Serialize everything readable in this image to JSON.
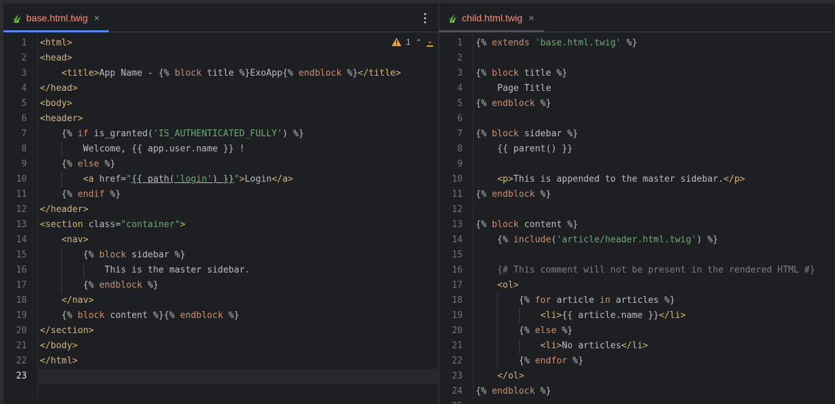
{
  "left_tab": {
    "label": "base.html.twig",
    "close": "×"
  },
  "right_tab": {
    "label": "child.html.twig",
    "close": "×"
  },
  "inspection": {
    "warning_count": "1",
    "up": "⌃",
    "down": "⌄"
  },
  "left_lines": [
    [
      [
        "t-tag",
        "<html>"
      ]
    ],
    [
      [
        "t-tag",
        "<head>"
      ]
    ],
    [
      [
        "t-txt",
        "    "
      ],
      [
        "t-tag",
        "<title>"
      ],
      [
        "t-txt",
        "App Name - {% "
      ],
      [
        "t-kw",
        "block"
      ],
      [
        "t-txt",
        " title %}ExoApp{% "
      ],
      [
        "t-kw",
        "endblock"
      ],
      [
        "t-txt",
        " %}"
      ],
      [
        "t-tag",
        "</title>"
      ]
    ],
    [
      [
        "t-tag",
        "</head>"
      ]
    ],
    [
      [
        "t-tag",
        "<body>"
      ]
    ],
    [
      [
        "t-tag",
        "<header>"
      ]
    ],
    [
      [
        "t-txt",
        "    {% "
      ],
      [
        "t-kw",
        "if"
      ],
      [
        "t-txt",
        " is_granted("
      ],
      [
        "t-str",
        "'IS_AUTHENTICATED_FULLY'"
      ],
      [
        "t-txt",
        ") %}"
      ]
    ],
    [
      [
        "t-txt",
        "        Welcome, {{ app.user.name }} !"
      ]
    ],
    [
      [
        "t-txt",
        "    {% "
      ],
      [
        "t-kw",
        "else"
      ],
      [
        "t-txt",
        " %}"
      ]
    ],
    [
      [
        "t-txt",
        "        "
      ],
      [
        "t-tag",
        "<a "
      ],
      [
        "t-attr",
        "href="
      ],
      [
        "t-str",
        "\""
      ],
      [
        "t-link",
        "{{ path("
      ],
      [
        "t-str t-link",
        "'login'"
      ],
      [
        "t-link",
        ") }}"
      ],
      [
        "t-str",
        "\""
      ],
      [
        "t-tag",
        ">"
      ],
      [
        "t-txt",
        "Login"
      ],
      [
        "t-tag",
        "</a>"
      ]
    ],
    [
      [
        "t-txt",
        "    {% "
      ],
      [
        "t-kw",
        "endif"
      ],
      [
        "t-txt",
        " %}"
      ]
    ],
    [
      [
        "t-tag",
        "</header>"
      ]
    ],
    [
      [
        "t-tag",
        "<section "
      ],
      [
        "t-attr",
        "class="
      ],
      [
        "t-str",
        "\"container\""
      ],
      [
        "t-tag",
        ">"
      ]
    ],
    [
      [
        "t-txt",
        "    "
      ],
      [
        "t-tag",
        "<nav>"
      ]
    ],
    [
      [
        "t-txt",
        "        {% "
      ],
      [
        "t-kw",
        "block"
      ],
      [
        "t-txt",
        " sidebar %}"
      ]
    ],
    [
      [
        "t-txt",
        "            This is the master sidebar."
      ]
    ],
    [
      [
        "t-txt",
        "        {% "
      ],
      [
        "t-kw",
        "endblock"
      ],
      [
        "t-txt",
        " %}"
      ]
    ],
    [
      [
        "t-txt",
        "    "
      ],
      [
        "t-tag",
        "</nav>"
      ]
    ],
    [
      [
        "t-txt",
        "    {% "
      ],
      [
        "t-kw",
        "block"
      ],
      [
        "t-txt",
        " content %}{% "
      ],
      [
        "t-kw",
        "endblock"
      ],
      [
        "t-txt",
        " %}"
      ]
    ],
    [
      [
        "t-tag",
        "</section>"
      ]
    ],
    [
      [
        "t-tag",
        "</body>"
      ]
    ],
    [
      [
        "t-tag",
        "</html>"
      ]
    ],
    []
  ],
  "right_lines": [
    [
      [
        "t-txt",
        "{% "
      ],
      [
        "t-kw",
        "extends"
      ],
      [
        "t-txt",
        " "
      ],
      [
        "t-str",
        "'base.html.twig'"
      ],
      [
        "t-txt",
        " %}"
      ]
    ],
    [],
    [
      [
        "t-txt",
        "{% "
      ],
      [
        "t-kw",
        "block"
      ],
      [
        "t-txt",
        " title %}"
      ]
    ],
    [
      [
        "t-txt",
        "    Page Title"
      ]
    ],
    [
      [
        "t-txt",
        "{% "
      ],
      [
        "t-kw",
        "endblock"
      ],
      [
        "t-txt",
        " %}"
      ]
    ],
    [],
    [
      [
        "t-txt",
        "{% "
      ],
      [
        "t-kw",
        "block"
      ],
      [
        "t-txt",
        " sidebar %}"
      ]
    ],
    [
      [
        "t-txt",
        "    {{ parent() }}"
      ]
    ],
    [],
    [
      [
        "t-txt",
        "    "
      ],
      [
        "t-tag",
        "<p>"
      ],
      [
        "t-txt",
        "This is appended to the master sidebar."
      ],
      [
        "t-tag",
        "</p>"
      ]
    ],
    [
      [
        "t-txt",
        "{% "
      ],
      [
        "t-kw",
        "endblock"
      ],
      [
        "t-txt",
        " %}"
      ]
    ],
    [],
    [
      [
        "t-txt",
        "{% "
      ],
      [
        "t-kw",
        "block"
      ],
      [
        "t-txt",
        " content %}"
      ]
    ],
    [
      [
        "t-txt",
        "    {% "
      ],
      [
        "t-kw",
        "include"
      ],
      [
        "t-txt",
        "("
      ],
      [
        "t-str",
        "'article/header.html.twig'"
      ],
      [
        "t-txt",
        ") %}"
      ]
    ],
    [],
    [
      [
        "t-txt",
        "    "
      ],
      [
        "t-cmt",
        "{# This comment will not be present in the rendered HTML #}"
      ]
    ],
    [
      [
        "t-txt",
        "    "
      ],
      [
        "t-tag",
        "<ol>"
      ]
    ],
    [
      [
        "t-txt",
        "        {% "
      ],
      [
        "t-kw",
        "for"
      ],
      [
        "t-txt",
        " article "
      ],
      [
        "t-kw",
        "in"
      ],
      [
        "t-txt",
        " articles %}"
      ]
    ],
    [
      [
        "t-txt",
        "            "
      ],
      [
        "t-tag",
        "<li>"
      ],
      [
        "t-txt",
        "{{ article.name }}"
      ],
      [
        "t-tag",
        "</li>"
      ]
    ],
    [
      [
        "t-txt",
        "        {% "
      ],
      [
        "t-kw",
        "else"
      ],
      [
        "t-txt",
        " %}"
      ]
    ],
    [
      [
        "t-txt",
        "            "
      ],
      [
        "t-tag",
        "<li>"
      ],
      [
        "t-txt",
        "No articles"
      ],
      [
        "t-tag",
        "</li>"
      ]
    ],
    [
      [
        "t-txt",
        "        {% "
      ],
      [
        "t-kw",
        "endfor"
      ],
      [
        "t-txt",
        " %}"
      ]
    ],
    [
      [
        "t-txt",
        "    "
      ],
      [
        "t-tag",
        "</ol>"
      ]
    ],
    [
      [
        "t-txt",
        "{% "
      ],
      [
        "t-kw",
        "endblock"
      ],
      [
        "t-txt",
        " %}"
      ]
    ],
    []
  ],
  "left_current_line": 23
}
